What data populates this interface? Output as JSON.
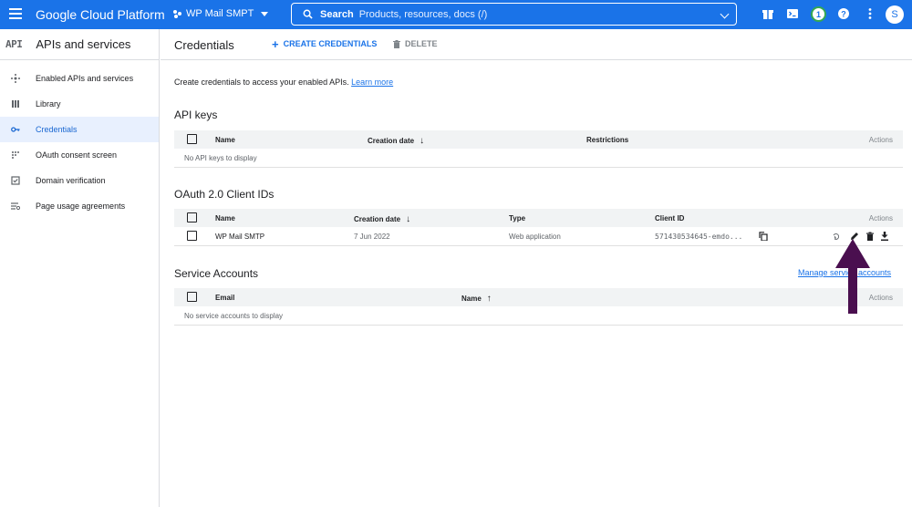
{
  "topbar": {
    "brand": "Google Cloud Platform",
    "project": "WP Mail SMPT",
    "search_label": "Search",
    "search_placeholder": "Products, resources, docs (/)",
    "notification_count": "1",
    "avatar_letter": "S"
  },
  "sidebar": {
    "logo": "API",
    "title": "APIs and services",
    "items": [
      {
        "label": "Enabled APIs and services",
        "icon": "hub-icon"
      },
      {
        "label": "Library",
        "icon": "library-icon"
      },
      {
        "label": "Credentials",
        "icon": "key-icon",
        "active": true
      },
      {
        "label": "OAuth consent screen",
        "icon": "consent-icon"
      },
      {
        "label": "Domain verification",
        "icon": "checkbox-icon"
      },
      {
        "label": "Page usage agreements",
        "icon": "settings-list-icon"
      }
    ]
  },
  "header": {
    "title": "Credentials",
    "create_label": "CREATE CREDENTIALS",
    "delete_label": "DELETE"
  },
  "intro": {
    "text": "Create credentials to access your enabled APIs.",
    "link": "Learn more"
  },
  "api_keys": {
    "title": "API keys",
    "columns": {
      "name": "Name",
      "creation_date": "Creation date",
      "restrictions": "Restrictions",
      "actions": "Actions"
    },
    "empty": "No API keys to display"
  },
  "oauth": {
    "title": "OAuth 2.0 Client IDs",
    "columns": {
      "name": "Name",
      "creation_date": "Creation date",
      "type": "Type",
      "client_id": "Client ID",
      "actions": "Actions"
    },
    "rows": [
      {
        "name": "WP Mail SMTP",
        "creation_date": "7 Jun 2022",
        "type": "Web application",
        "client_id": "571430534645-emdo..."
      }
    ]
  },
  "service_accounts": {
    "title": "Service Accounts",
    "manage_link": "Manage service accounts",
    "columns": {
      "email": "Email",
      "name": "Name",
      "actions": "Actions"
    },
    "empty": "No service accounts to display"
  },
  "colors": {
    "brand_blue": "#1a73e8",
    "annotation_arrow": "#4a0f4f"
  }
}
